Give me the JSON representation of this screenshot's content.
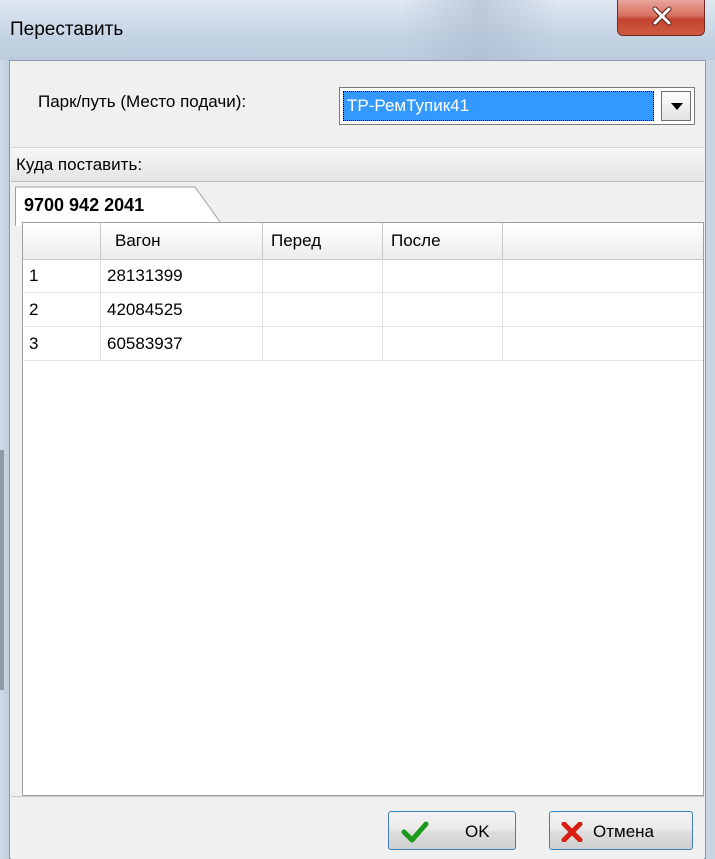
{
  "window": {
    "title": "Переставить",
    "close_icon": "close-icon",
    "accent": "#c2432f"
  },
  "park": {
    "label": "Парк/путь (Место подачи):",
    "selected": "ТР-РемТупик41",
    "dropdown_icon": "chevron-down-icon",
    "highlight": "#3399ff"
  },
  "section": {
    "title": "Куда поставить:"
  },
  "tabs": [
    {
      "label": "9700 942 2041"
    }
  ],
  "table": {
    "columns": [
      "",
      "Вагон",
      "Перед",
      "После",
      ""
    ],
    "rows": [
      [
        "1",
        "28131399",
        "",
        ""
      ],
      [
        "2",
        "42084525",
        "",
        ""
      ],
      [
        "3",
        "60583937",
        "",
        ""
      ]
    ]
  },
  "buttons": {
    "ok": {
      "label": "OK",
      "icon": "checkmark-icon",
      "icon_color": "#1a9a1a"
    },
    "cancel": {
      "label": "Отмена",
      "icon": "x-icon",
      "icon_color": "#d81d12"
    }
  }
}
